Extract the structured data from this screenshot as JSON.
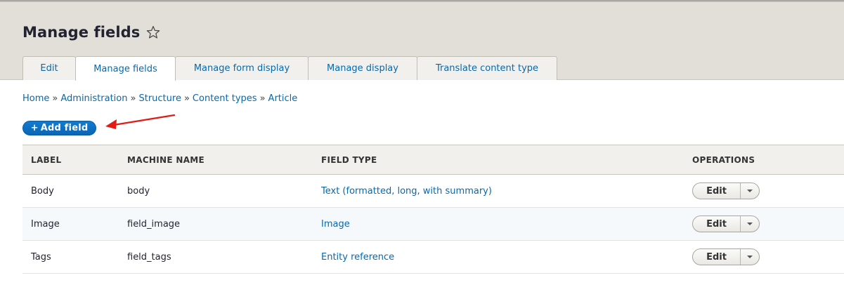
{
  "page": {
    "title": "Manage fields",
    "star_icon": "star-outline-icon"
  },
  "tabs": [
    {
      "label": "Edit",
      "active": false
    },
    {
      "label": "Manage fields",
      "active": true
    },
    {
      "label": "Manage form display",
      "active": false
    },
    {
      "label": "Manage display",
      "active": false
    },
    {
      "label": "Translate content type",
      "active": false
    }
  ],
  "breadcrumb": {
    "separator": "»",
    "items": [
      "Home",
      "Administration",
      "Structure",
      "Content types",
      "Article"
    ]
  },
  "add_field": {
    "icon": "+",
    "label": "Add field"
  },
  "annotation": {
    "icon": "red-arrow-icon",
    "color": "#e31b17"
  },
  "table": {
    "headers": {
      "label": "Label",
      "machine_name": "Machine name",
      "field_type": "Field type",
      "operations": "Operations"
    },
    "rows": [
      {
        "label": "Body",
        "machine_name": "body",
        "field_type": "Text (formatted, long, with summary)",
        "op_label": "Edit"
      },
      {
        "label": "Image",
        "machine_name": "field_image",
        "field_type": "Image",
        "op_label": "Edit"
      },
      {
        "label": "Tags",
        "machine_name": "field_tags",
        "field_type": "Entity reference",
        "op_label": "Edit"
      }
    ]
  },
  "colors": {
    "link": "#0769ad",
    "primary_button": "#0d74c3",
    "header_bg": "#e1dfd8"
  }
}
